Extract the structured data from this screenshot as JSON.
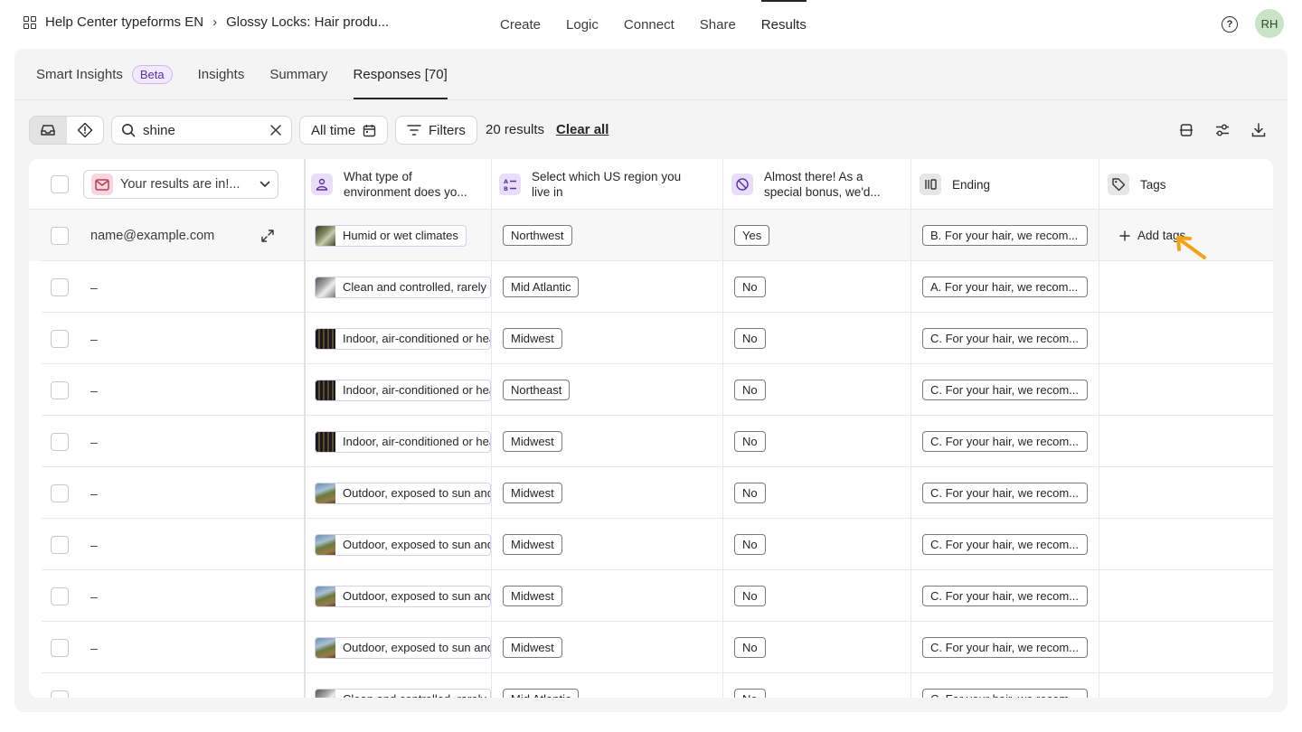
{
  "breadcrumb": {
    "workspace": "Help Center typeforms EN",
    "separator": "›",
    "form": "Glossy Locks: Hair produ..."
  },
  "topnav": [
    "Create",
    "Logic",
    "Connect",
    "Share",
    "Results"
  ],
  "user": {
    "initials": "RH",
    "help": "?"
  },
  "tabs": {
    "smart_insights": "Smart Insights",
    "beta": "Beta",
    "insights": "Insights",
    "summary": "Summary",
    "responses": "Responses [70]"
  },
  "toolbar": {
    "search_value": "shine",
    "date_filter": "All time",
    "filters": "Filters",
    "results": "20 results",
    "clear_all": "Clear all"
  },
  "columns": {
    "email_select": "Your results are in!...",
    "q1": "What type of environment does yo...",
    "q2": "Select which US region you live in",
    "q3": "Almost there! As a special bonus, we'd...",
    "ending": "Ending",
    "tags": "Tags"
  },
  "rows": [
    {
      "email": "name@example.com",
      "env": "Humid or wet climates",
      "env_kind": "humid",
      "region": "Northwest",
      "bonus": "Yes",
      "ending": "B. For your hair, we recom...",
      "tags": "Add tags"
    },
    {
      "email": "–",
      "env": "Clean and controlled, rarely exposed",
      "env_kind": "clean",
      "region": "Mid Atlantic",
      "bonus": "No",
      "ending": "A. For your hair, we recom..."
    },
    {
      "email": "–",
      "env": "Indoor, air-conditioned or heated",
      "env_kind": "indoor",
      "region": "Midwest",
      "bonus": "No",
      "ending": "C. For your hair, we recom..."
    },
    {
      "email": "–",
      "env": "Indoor, air-conditioned or heated",
      "env_kind": "indoor",
      "region": "Northeast",
      "bonus": "No",
      "ending": "C. For your hair, we recom..."
    },
    {
      "email": "–",
      "env": "Indoor, air-conditioned or heated",
      "env_kind": "indoor",
      "region": "Midwest",
      "bonus": "No",
      "ending": "C. For your hair, we recom..."
    },
    {
      "email": "–",
      "env": "Outdoor, exposed to sun and wind",
      "env_kind": "outdoor",
      "region": "Midwest",
      "bonus": "No",
      "ending": "C. For your hair, we recom..."
    },
    {
      "email": "–",
      "env": "Outdoor, exposed to sun and wind",
      "env_kind": "outdoor",
      "region": "Midwest",
      "bonus": "No",
      "ending": "C. For your hair, we recom..."
    },
    {
      "email": "–",
      "env": "Outdoor, exposed to sun and wind",
      "env_kind": "outdoor",
      "region": "Midwest",
      "bonus": "No",
      "ending": "C. For your hair, we recom..."
    },
    {
      "email": "–",
      "env": "Outdoor, exposed to sun and wind",
      "env_kind": "outdoor",
      "region": "Midwest",
      "bonus": "No",
      "ending": "C. For your hair, we recom..."
    },
    {
      "email": "–",
      "env": "Clean and controlled, rarely exposed",
      "env_kind": "clean",
      "region": "Mid Atlantic",
      "bonus": "No",
      "ending": "C. For your hair, we recom..."
    }
  ],
  "colors": {
    "accent_arrow": "#f5a314",
    "email_icon": "#f7d6de",
    "q1_icon": "#e9defa",
    "q2_icon": "#e9defa",
    "q3_icon": "#e9defa",
    "ending_icon": "#e6e6e6",
    "tags_icon": "#e6e6e6"
  }
}
